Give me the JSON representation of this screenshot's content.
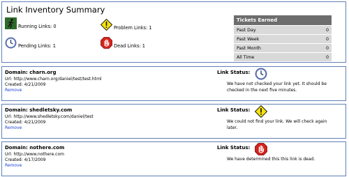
{
  "summary": {
    "title": "Link Inventory Summary",
    "running_label": "Running Links: 0",
    "pending_label": "Pending Links: 1",
    "problem_label": "Problem Links: 1",
    "dead_label": "Dead Links: 1",
    "icons": {
      "running": "running-man-icon",
      "pending": "clock-icon",
      "problem": "warning-icon",
      "dead": "stop-hand-icon"
    }
  },
  "tickets": {
    "header": "Tickets Earned",
    "rows": [
      {
        "label": "Past Day",
        "value": "0"
      },
      {
        "label": "Past Week",
        "value": "0"
      },
      {
        "label": "Past Month",
        "value": "0"
      },
      {
        "label": "All Time",
        "value": "0"
      }
    ]
  },
  "links": [
    {
      "domain_label": "Domain:",
      "domain": "charn.org",
      "url": "Url: http://www.charn.org/daniel/test/test.html",
      "created": "Created: 4/21/2009",
      "remove_label": "Remove",
      "status_label": "Link Status:",
      "status_icon": "clock-icon",
      "status_message": "We have not checked your link yet. It should be checked in the next five minutes."
    },
    {
      "domain_label": "Domain:",
      "domain": "shedletsky.com",
      "url": "Url: http://www.shedletsky.com/daniel/test",
      "created": "Created: 4/21/2009",
      "remove_label": "Remove",
      "status_label": "Link Status:",
      "status_icon": "warning-icon",
      "status_message": "We could not find your link. We will check again later."
    },
    {
      "domain_label": "Domain:",
      "domain": "nothere.com",
      "url": "Url: http://www.nothere.com",
      "created": "Created: 4/17/2009",
      "remove_label": "Remove",
      "status_label": "Link Status:",
      "status_icon": "stop-hand-icon",
      "status_message": "We have determined this this link is dead."
    }
  ],
  "colors": {
    "panel_border": "#5f80b6",
    "table_header": "#6d6d6d",
    "table_row": "#d9d9d9",
    "link_blue": "#1d3fd0"
  }
}
